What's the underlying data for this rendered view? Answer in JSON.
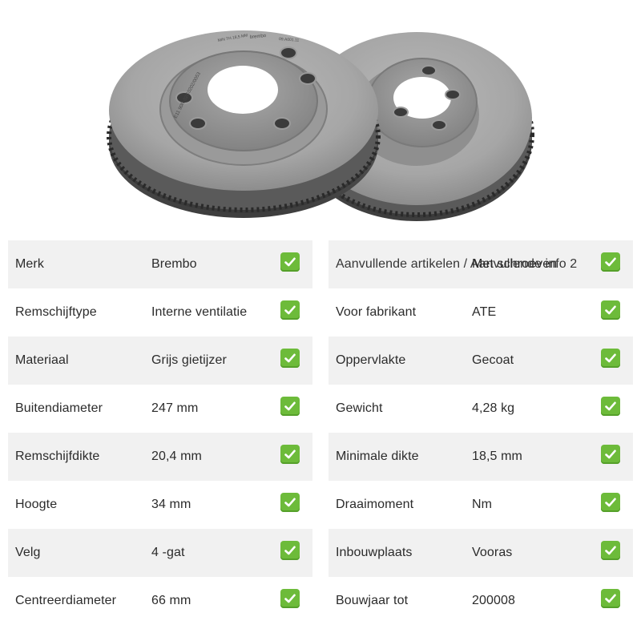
{
  "product": {
    "disc_marking": "E11 90R-02C0202/0053",
    "brand_marking": "brembo",
    "min_thickness_marking": "MIN TH 18,5 MM",
    "part_marking": "09.A001.11"
  },
  "icons": {
    "check": "green-checkmark-icon"
  },
  "colors": {
    "check_bg": "#6dbb3a",
    "row_shade": "#f1f1f1",
    "text": "#2b2b2b"
  },
  "specs": {
    "left": [
      {
        "label": "Merk",
        "value": "Brembo"
      },
      {
        "label": "Remschijftype",
        "value": "Interne ventilatie"
      },
      {
        "label": "Materiaal",
        "value": "Grijs gietijzer"
      },
      {
        "label": "Buitendiameter",
        "value": "247 mm"
      },
      {
        "label": "Remschijfdikte",
        "value": "20,4 mm"
      },
      {
        "label": "Hoogte",
        "value": "34 mm"
      },
      {
        "label": "Velg",
        "value": "4 -gat"
      },
      {
        "label": "Centreerdiameter",
        "value": "66 mm"
      }
    ],
    "right": [
      {
        "label": "Aanvullende artikelen / Aanvullende info 2",
        "value": "Met schroeven"
      },
      {
        "label": "Voor fabrikant",
        "value": "ATE"
      },
      {
        "label": "Oppervlakte",
        "value": "Gecoat"
      },
      {
        "label": "Gewicht",
        "value": "4,28 kg"
      },
      {
        "label": "Minimale dikte",
        "value": "18,5 mm"
      },
      {
        "label": "Draaimoment",
        "value": "Nm"
      },
      {
        "label": "Inbouwplaats",
        "value": "Vooras"
      },
      {
        "label": "Bouwjaar tot",
        "value": "200008"
      }
    ]
  }
}
